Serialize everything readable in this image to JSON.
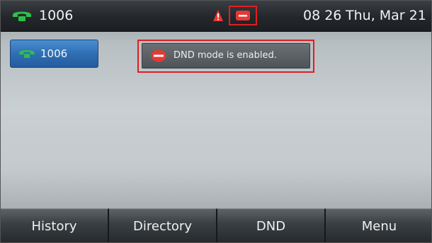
{
  "status_bar": {
    "extension": "1006",
    "time": "08 26",
    "date": "Thu, Mar 21"
  },
  "line_key": {
    "label": "1006"
  },
  "notification": {
    "text": "DND mode is enabled."
  },
  "softkeys": [
    {
      "label": "History"
    },
    {
      "label": "Directory"
    },
    {
      "label": "DND"
    },
    {
      "label": "Menu"
    }
  ],
  "colors": {
    "highlight": "#e01e22",
    "dnd_icon": "#e53935",
    "handset": "#2fbf4a",
    "line_key": "#2f6fb4"
  },
  "icons": {
    "status_phone": "handset-icon",
    "alert": "alert-icon",
    "dnd": "dnd-icon"
  }
}
